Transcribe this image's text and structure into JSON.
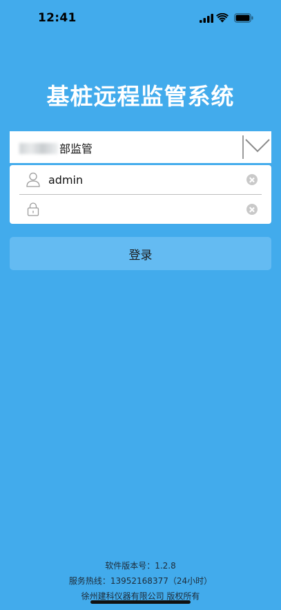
{
  "status_bar": {
    "time": "12:41"
  },
  "app": {
    "title": "基桩远程监管系统"
  },
  "department": {
    "visible_text": "部监管"
  },
  "login": {
    "username_value": "admin",
    "password_value": "",
    "button_label": "登录"
  },
  "footer": {
    "version": "软件版本号：1.2.8",
    "hotline": "服务热线：13952168377（24小时）",
    "copyright": "徐州建科仪器有限公司 版权所有"
  },
  "colors": {
    "background": "#42abec",
    "button": "#64bbf2",
    "card": "#ffffff"
  }
}
